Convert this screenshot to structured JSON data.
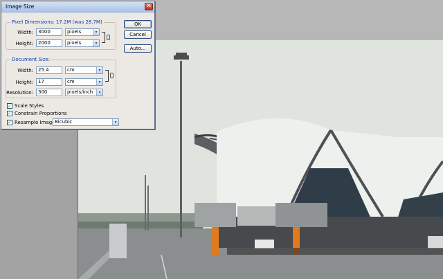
{
  "dialog": {
    "title": "Image Size",
    "close_symbol": "✕",
    "pixel_dimensions": {
      "legend": "Pixel Dimensions:  17.2M (was 28.7M)",
      "width_label": "Width:",
      "width_value": "3000",
      "width_unit": "pixels",
      "height_label": "Height:",
      "height_value": "2000",
      "height_unit": "pixels"
    },
    "document_size": {
      "legend": "Document Size:",
      "width_label": "Width:",
      "width_value": "25.4",
      "width_unit": "cm",
      "height_label": "Height:",
      "height_value": "17",
      "height_unit": "cm",
      "resolution_label": "Resolution:",
      "resolution_value": "300",
      "resolution_unit": "pixels/inch"
    },
    "buttons": {
      "ok": "OK",
      "cancel": "Cancel",
      "auto": "Auto..."
    },
    "options": {
      "scale_styles": "Scale Styles",
      "constrain_proportions": "Constrain Proportions",
      "resample_image": "Resample Image:",
      "resample_method": "Bicubic",
      "check_mark": "✓"
    },
    "dropdown_arrow": "▾"
  },
  "colors": {
    "legend_blue": "#0a3cae",
    "title_gradient_top": "#d6e3f7",
    "close_red": "#b4331f"
  }
}
